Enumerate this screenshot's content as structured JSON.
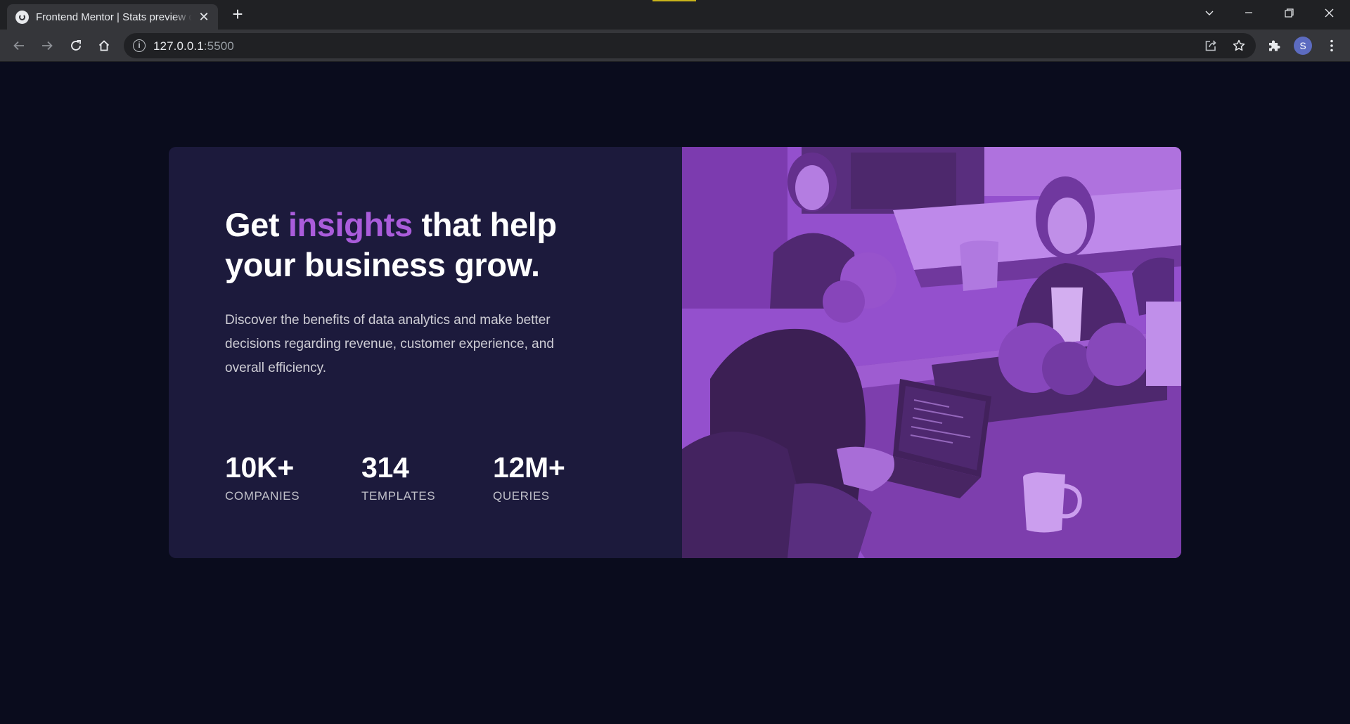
{
  "browser": {
    "tab_title": "Frontend Mentor | Stats preview card component",
    "url_host": "127.0.0.1",
    "url_port": ":5500",
    "profile_initial": "S"
  },
  "card": {
    "headline_start": "Get ",
    "headline_accent": "insights",
    "headline_end": " that help your business grow.",
    "description": "Discover the benefits of data analytics and make better decisions regarding revenue, customer experience, and overall efficiency.",
    "stats": [
      {
        "value": "10K+",
        "label": "COMPANIES"
      },
      {
        "value": "314",
        "label": "TEMPLATES"
      },
      {
        "value": "12M+",
        "label": "QUERIES"
      }
    ],
    "image_tint": "#aa5cdb"
  },
  "colors": {
    "page_background": "#0a0c1d",
    "card_background": "#1c1a3c",
    "accent": "#aa5cdb"
  }
}
